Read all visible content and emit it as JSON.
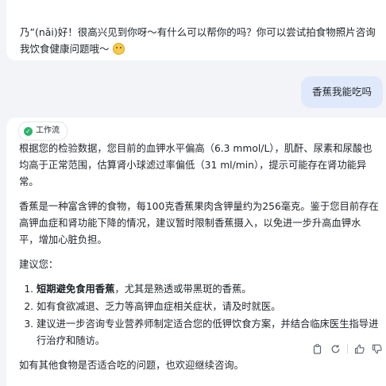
{
  "greeting": {
    "text": "乃”(nǎi)好！很高兴见到你呀～有什么可以帮你的吗？你可以尝试拍食物照片咨询我饮食健康问题哦～",
    "emoji": "smile-emoji"
  },
  "user_message": "香蕉我能吃吗",
  "answer": {
    "workflow_badge": "工作流",
    "p1": "根据您的检验数据，您目前的血钾水平偏高（6.3 mmol/L），肌酐、尿素和尿酸也均高于正常范围，估算肾小球滤过率偏低（31 ml/min），提示可能存在肾功能异常。",
    "p2": "香蕉是一种富含钾的食物，每100克香蕉果肉含钾量约为256毫克。鉴于您目前存在高钾血症和肾功能下降的情况，建议暂时限制香蕉摄入，以免进一步升高血钾水平，增加心脏负担。",
    "advice_heading": "建议您：",
    "list": [
      {
        "bold": "短期避免食用香蕉",
        "rest": "，尤其是熟透或带黑斑的香蕉。"
      },
      {
        "bold": "",
        "rest": "如有食欲减退、乏力等高钾血症相关症状，请及时就医。"
      },
      {
        "bold": "",
        "rest": "建议进一步咨询专业营养师制定适合您的低钾饮食方案，并结合临床医生指导进行治疗和随访。"
      }
    ],
    "closing": "如有其他食物是否适合吃的问题，也欢迎继续咨询。"
  },
  "actions": [
    "copy-icon",
    "refresh-icon",
    "thumbs-up-icon",
    "thumbs-down-icon"
  ]
}
